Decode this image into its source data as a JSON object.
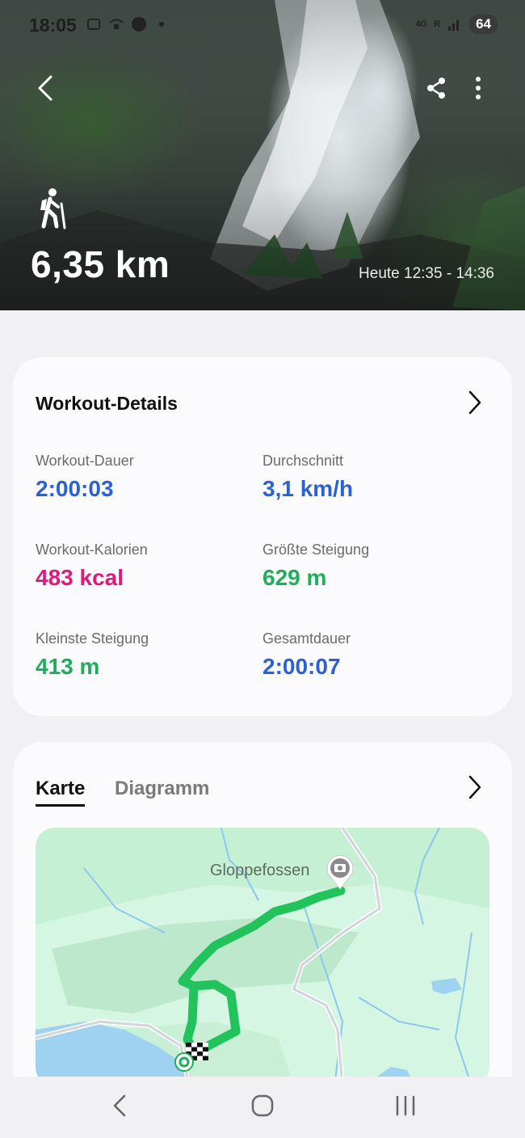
{
  "status_bar": {
    "time": "18:05",
    "network": "4G",
    "roaming": "R",
    "battery": "64"
  },
  "hero": {
    "distance": "6,35 km",
    "time_range": "Heute 12:35 - 14:36"
  },
  "details": {
    "title": "Workout-Details",
    "stats": [
      {
        "label": "Workout-Dauer",
        "value": "2:00:03",
        "color": "#2a62d6"
      },
      {
        "label": "Durchschnitt",
        "value": "3,1 km/h",
        "color": "#2a62d6"
      },
      {
        "label": "Workout-Kalorien",
        "value": "483 kcal",
        "color": "#e0197a"
      },
      {
        "label": "Größte Steigung",
        "value": "629 m",
        "color": "#1fae5a"
      },
      {
        "label": "Kleinste Steigung",
        "value": "413 m",
        "color": "#1fae5a"
      },
      {
        "label": "Gesamtdauer",
        "value": "2:00:07",
        "color": "#2a62d6"
      }
    ]
  },
  "map_card": {
    "tabs": [
      {
        "label": "Karte",
        "active": true
      },
      {
        "label": "Diagramm",
        "active": false
      }
    ],
    "place_label": "Gloppefossen",
    "route_color": "#22c25c"
  },
  "icons": {
    "back": "chevron-left-icon",
    "share": "share-icon",
    "more": "more-vertical-icon",
    "activity": "hiking-icon",
    "camera": "camera-icon",
    "finish": "finish-flag-icon",
    "start": "start-marker-icon"
  }
}
